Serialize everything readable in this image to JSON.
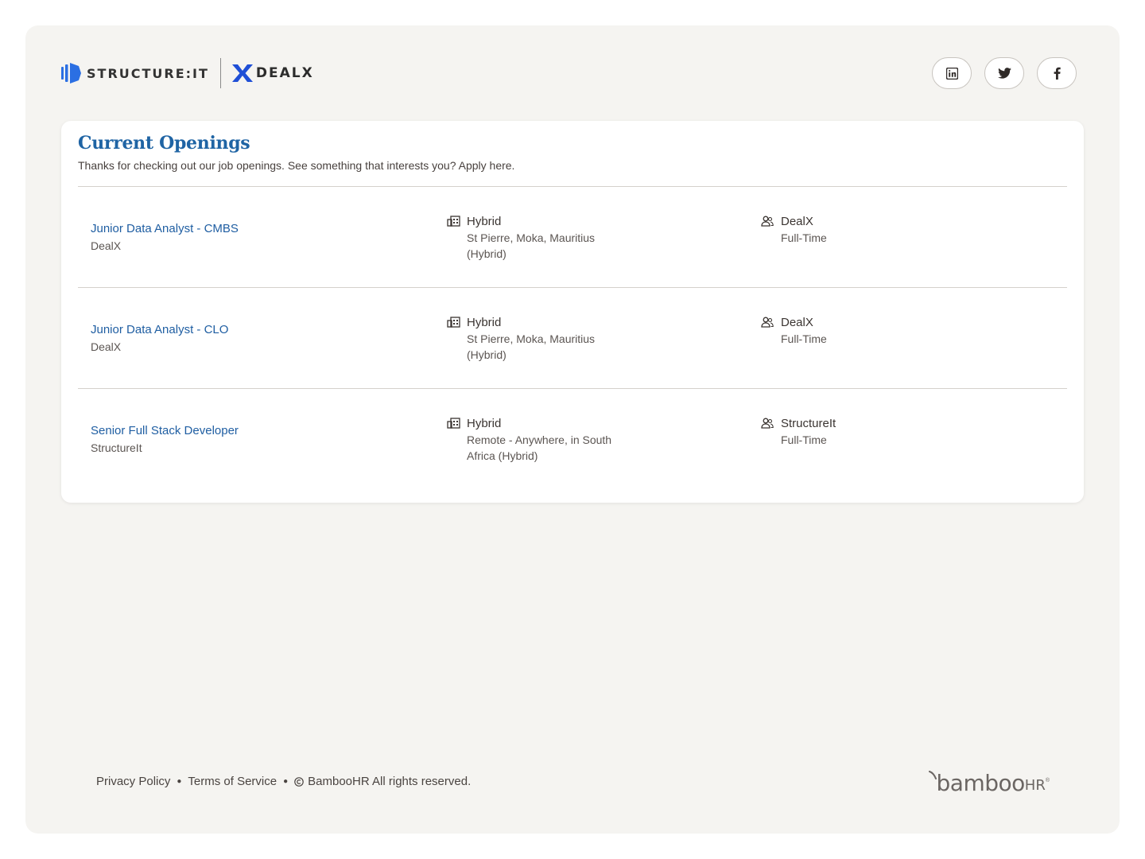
{
  "header": {
    "logo_structure": "STRUCTURE:IT",
    "logo_dealx": "DEALX",
    "socials": [
      {
        "name": "linkedin",
        "icon": "linkedin-icon"
      },
      {
        "name": "twitter",
        "icon": "twitter-icon"
      },
      {
        "name": "facebook",
        "icon": "facebook-icon"
      }
    ]
  },
  "openings": {
    "title": "Current Openings",
    "subtitle": "Thanks for checking out our job openings. See something that interests you? Apply here.",
    "jobs": [
      {
        "title": "Junior Data Analyst - CMBS",
        "department": "DealX",
        "location_type": "Hybrid",
        "location": "St Pierre, Moka, Mauritius (Hybrid)",
        "company": "DealX",
        "employment": "Full-Time"
      },
      {
        "title": "Junior Data Analyst - CLO",
        "department": "DealX",
        "location_type": "Hybrid",
        "location": "St Pierre, Moka, Mauritius (Hybrid)",
        "company": "DealX",
        "employment": "Full-Time"
      },
      {
        "title": "Senior Full Stack Developer",
        "department": "StructureIt",
        "location_type": "Hybrid",
        "location": "Remote - Anywhere, in South Africa (Hybrid)",
        "company": "StructureIt",
        "employment": "Full-Time"
      }
    ]
  },
  "footer": {
    "privacy": "Privacy Policy",
    "terms": "Terms of Service",
    "copyright": "BambooHR All rights reserved.",
    "brand": "bamboo",
    "brand_suffix": "HR"
  },
  "colors": {
    "accent": "#1f64a4",
    "link": "#1f5ea2",
    "frame_bg": "#f5f4f1",
    "structure_blue": "#2b6fe3"
  }
}
